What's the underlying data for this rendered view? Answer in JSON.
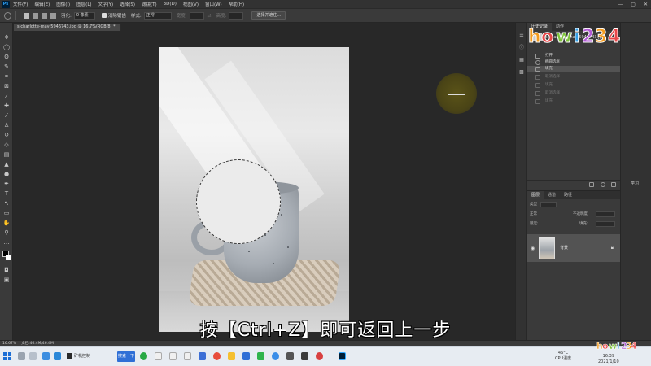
{
  "menubar": {
    "items": [
      "文件(F)",
      "编辑(E)",
      "图像(I)",
      "图层(L)",
      "文字(Y)",
      "选择(S)",
      "滤镜(T)",
      "3D(D)",
      "视图(V)",
      "窗口(W)",
      "帮助(H)"
    ],
    "logo_text": "Ps"
  },
  "options": {
    "feather_label": "羽化:",
    "feather_value": "0 像素",
    "antialias_label": "消除锯齿",
    "style_label": "样式:",
    "style_value": "正常",
    "width_label": "宽度:",
    "height_label": "高度:",
    "select_mask_button": "选择并遮住..."
  },
  "document": {
    "tab_title": "s-charlotte-may-5946743.jpg @ 16.7%(RGB/8) *"
  },
  "history": {
    "tabs": [
      "历史记录",
      "动作"
    ],
    "snapshot_title": "s-charlotte-may-5946743.jpg",
    "rows": [
      {
        "label": "打开",
        "state": "normal"
      },
      {
        "label": "椭圆选框",
        "state": "normal"
      },
      {
        "label": "填充",
        "state": "active"
      },
      {
        "label": "取消选择",
        "state": "dim"
      },
      {
        "label": "填充",
        "state": "dim"
      },
      {
        "label": "取消选择",
        "state": "dim"
      },
      {
        "label": "填充",
        "state": "dim"
      }
    ]
  },
  "learn": {
    "label": "学习"
  },
  "layers": {
    "tabs": [
      "图层",
      "通道",
      "路径"
    ],
    "kind_label": "类型",
    "blend_mode": "正常",
    "opacity_label": "不透明度:",
    "lock_label": "锁定:",
    "fill_label": "填充:",
    "layer_name": "背景"
  },
  "status": {
    "zoom": "16.67%",
    "doc_info": "文档:46.4M/46.4M"
  },
  "taskbar": {
    "app_label": "矿机控制",
    "search_label": "搜索一下",
    "temp": "46°C",
    "temp_label": "CPU温度",
    "time": "16:39",
    "date": "2021/1/10"
  },
  "caption": "按【Ctrl+Z】即可返回上一步",
  "colors": {
    "accent": "#31a8ff",
    "logo_colors": [
      "#f39b1f",
      "#e8484a",
      "#7dc13a",
      "#35a0e8",
      "#b25ad6"
    ]
  }
}
